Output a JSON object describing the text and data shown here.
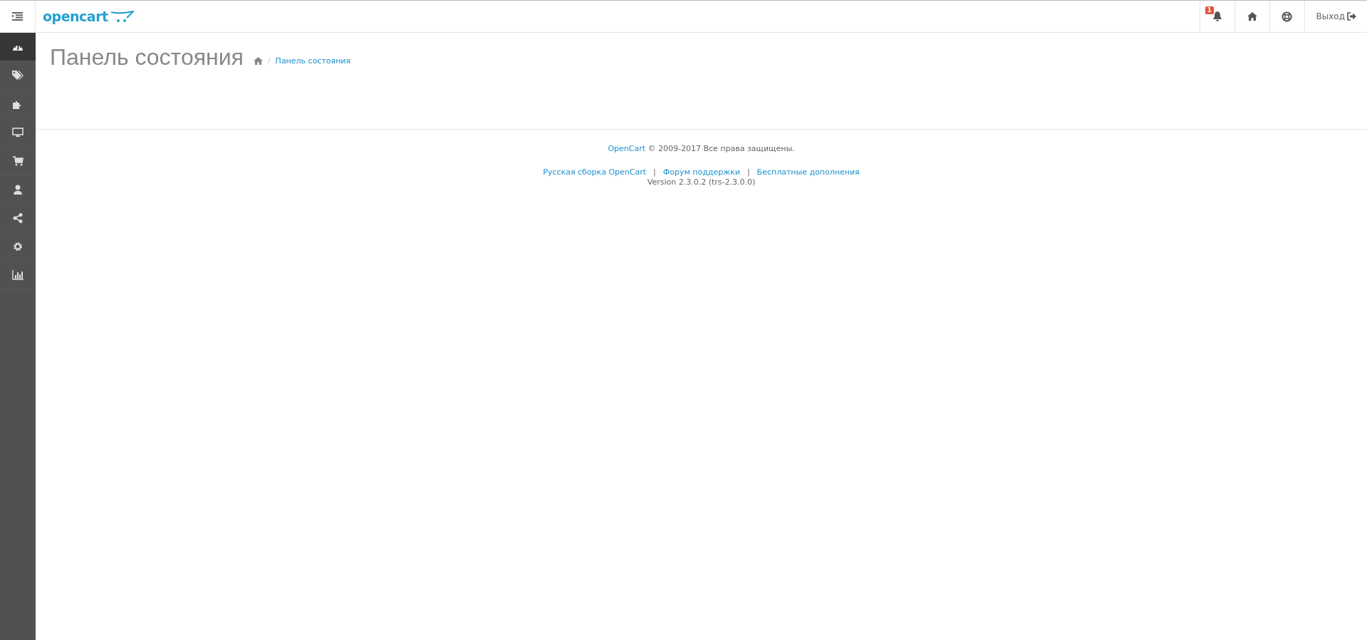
{
  "header": {
    "logo": "opencart",
    "notifications": {
      "count": "1"
    },
    "logout": "Выход"
  },
  "sidebar": {
    "items": [
      {
        "selected": true
      },
      {
        "selected": false
      },
      {
        "selected": false
      },
      {
        "selected": false
      },
      {
        "selected": false
      },
      {
        "selected": false
      },
      {
        "selected": false
      },
      {
        "selected": false
      },
      {
        "selected": false
      }
    ]
  },
  "page": {
    "title": "Панель состояния",
    "breadcrumb": [
      {
        "label": "Панель состояния"
      }
    ],
    "breadcrumb_separator": "/"
  },
  "footer": {
    "brand_link": "OpenCart",
    "copyright": "© 2009-2017 Все права защищены.",
    "links": [
      "Русская сборка OpenCart",
      "Форум поддержки",
      "Бесплатные дополнения"
    ],
    "separator": "|",
    "version": "Version 2.3.0.2 (trs-2.3.0.0)"
  }
}
